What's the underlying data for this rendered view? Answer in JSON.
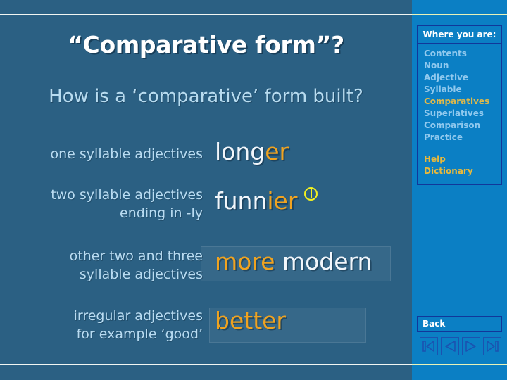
{
  "slide": {
    "title": "“Comparative form”?",
    "subtitle": "How is a ‘comparative’ form built?",
    "rows": [
      {
        "label_lines": [
          "one syllable adjectives"
        ],
        "example_parts": [
          {
            "text": "long",
            "color": "white"
          },
          {
            "text": "er",
            "color": "orange"
          }
        ],
        "has_note_marker": false,
        "highlighted": false
      },
      {
        "label_lines": [
          "two syllable adjectives",
          "ending in -ly"
        ],
        "example_parts": [
          {
            "text": "funn",
            "color": "white"
          },
          {
            "text": "ier",
            "color": "orange"
          }
        ],
        "has_note_marker": true,
        "highlighted": false
      },
      {
        "label_lines": [
          "other two and three",
          "syllable adjectives"
        ],
        "example_parts": [
          {
            "text": "more",
            "color": "orange"
          },
          {
            "text": " modern",
            "color": "white"
          }
        ],
        "has_note_marker": false,
        "highlighted": true
      },
      {
        "label_lines": [
          "irregular adjectives",
          "for example ‘good’"
        ],
        "example_parts": [
          {
            "text": "better",
            "color": "orange"
          }
        ],
        "has_note_marker": false,
        "highlighted": true
      }
    ]
  },
  "sidebar": {
    "header": "Where you are:",
    "items": [
      {
        "label": "Contents",
        "current": false
      },
      {
        "label": "Noun",
        "current": false
      },
      {
        "label": "Adjective",
        "current": false
      },
      {
        "label": "Syllable",
        "current": false
      },
      {
        "label": "Comparatives",
        "current": true
      },
      {
        "label": "Superlatives",
        "current": false
      },
      {
        "label": "Comparison",
        "current": false
      },
      {
        "label": "Practice",
        "current": false
      }
    ],
    "links": [
      {
        "label": "Help"
      },
      {
        "label": "Dictionary"
      }
    ],
    "back_label": "Back",
    "nav_buttons": [
      {
        "name": "first-slide-button",
        "icon": "skip-back-icon"
      },
      {
        "name": "previous-slide-button",
        "icon": "play-back-icon"
      },
      {
        "name": "next-slide-button",
        "icon": "play-forward-icon"
      },
      {
        "name": "last-slide-button",
        "icon": "skip-forward-icon"
      }
    ]
  },
  "colors": {
    "background": "#2b6083",
    "sidebar": "#0b7fc4",
    "accent_orange": "#f0a320",
    "label_blue": "#b9dcf2",
    "current_item": "#e0b94a",
    "link_gold": "#e8b93c",
    "marker_yellow": "#f3f11e",
    "rule_white": "#f2f6f2"
  }
}
